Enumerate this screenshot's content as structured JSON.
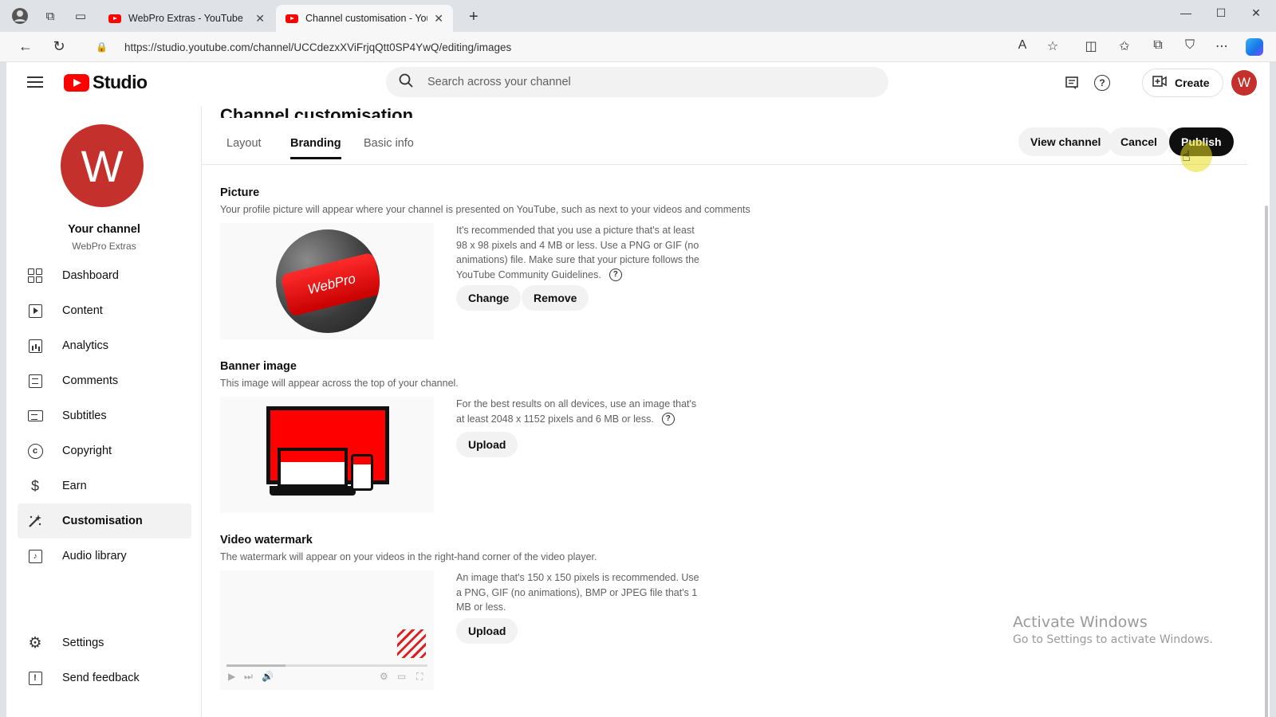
{
  "browser": {
    "tabs": [
      {
        "title": "WebPro Extras - YouTube",
        "active": false
      },
      {
        "title": "Channel customisation - YouTube",
        "active": true
      }
    ],
    "url": "https://studio.youtube.com/channel/UCCdezxXViFrjqQtt0SP4YwQ/editing/images",
    "icons": [
      "profile-icon",
      "workspaces-icon",
      "tab-actions-icon",
      "back-icon",
      "refresh-icon",
      "read-aloud-icon",
      "favorite-icon",
      "split-screen-icon",
      "favorites-icon",
      "collections-icon",
      "extensions-icon",
      "more-icon",
      "copilot-icon"
    ]
  },
  "header": {
    "logo_text": "Studio",
    "search_placeholder": "Search across your channel",
    "create_label": "Create",
    "avatar_letter": "W",
    "accent_color": "#ff0000",
    "avatar_color": "#c4302b"
  },
  "sidebar": {
    "avatar_letter": "W",
    "your_channel": "Your channel",
    "channel_name": "WebPro Extras",
    "items": [
      {
        "label": "Dashboard",
        "icon": "dashboard-icon"
      },
      {
        "label": "Content",
        "icon": "content-icon"
      },
      {
        "label": "Analytics",
        "icon": "analytics-icon"
      },
      {
        "label": "Comments",
        "icon": "comments-icon"
      },
      {
        "label": "Subtitles",
        "icon": "subtitles-icon"
      },
      {
        "label": "Copyright",
        "icon": "copyright-icon"
      },
      {
        "label": "Earn",
        "icon": "earn-icon"
      },
      {
        "label": "Customisation",
        "icon": "customisation-icon",
        "active": true
      },
      {
        "label": "Audio library",
        "icon": "audio-library-icon"
      }
    ],
    "bottom_items": [
      {
        "label": "Settings",
        "icon": "settings-icon"
      },
      {
        "label": "Send feedback",
        "icon": "feedback-icon"
      }
    ]
  },
  "main": {
    "title": "Channel customisation",
    "tabs": [
      {
        "label": "Layout"
      },
      {
        "label": "Branding",
        "active": true
      },
      {
        "label": "Basic info"
      }
    ],
    "actions": {
      "view_channel": "View channel",
      "cancel": "Cancel",
      "publish": "Publish"
    },
    "picture": {
      "title": "Picture",
      "description": "Your profile picture will appear where your channel is presented on YouTube, such as next to your videos and comments",
      "preview_text": "WebPro",
      "hint": "It's recommended that you use a picture that's at least 98 x 98 pixels and 4 MB or less. Use a PNG or GIF (no animations) file. Make sure that your picture follows the YouTube Community Guidelines.",
      "change_label": "Change",
      "remove_label": "Remove"
    },
    "banner": {
      "title": "Banner image",
      "description": "This image will appear across the top of your channel.",
      "hint": "For the best results on all devices, use an image that's at least 2048 x 1152 pixels and 6 MB or less.",
      "upload_label": "Upload"
    },
    "watermark": {
      "title": "Video watermark",
      "description": "The watermark will appear on your videos in the right-hand corner of the video player.",
      "hint": "An image that's 150 x 150 pixels is recommended. Use a PNG, GIF (no animations), BMP or JPEG file that's 1 MB or less.",
      "upload_label": "Upload"
    }
  },
  "os_watermark": {
    "line1": "Activate Windows",
    "line2": "Go to Settings to activate Windows."
  }
}
